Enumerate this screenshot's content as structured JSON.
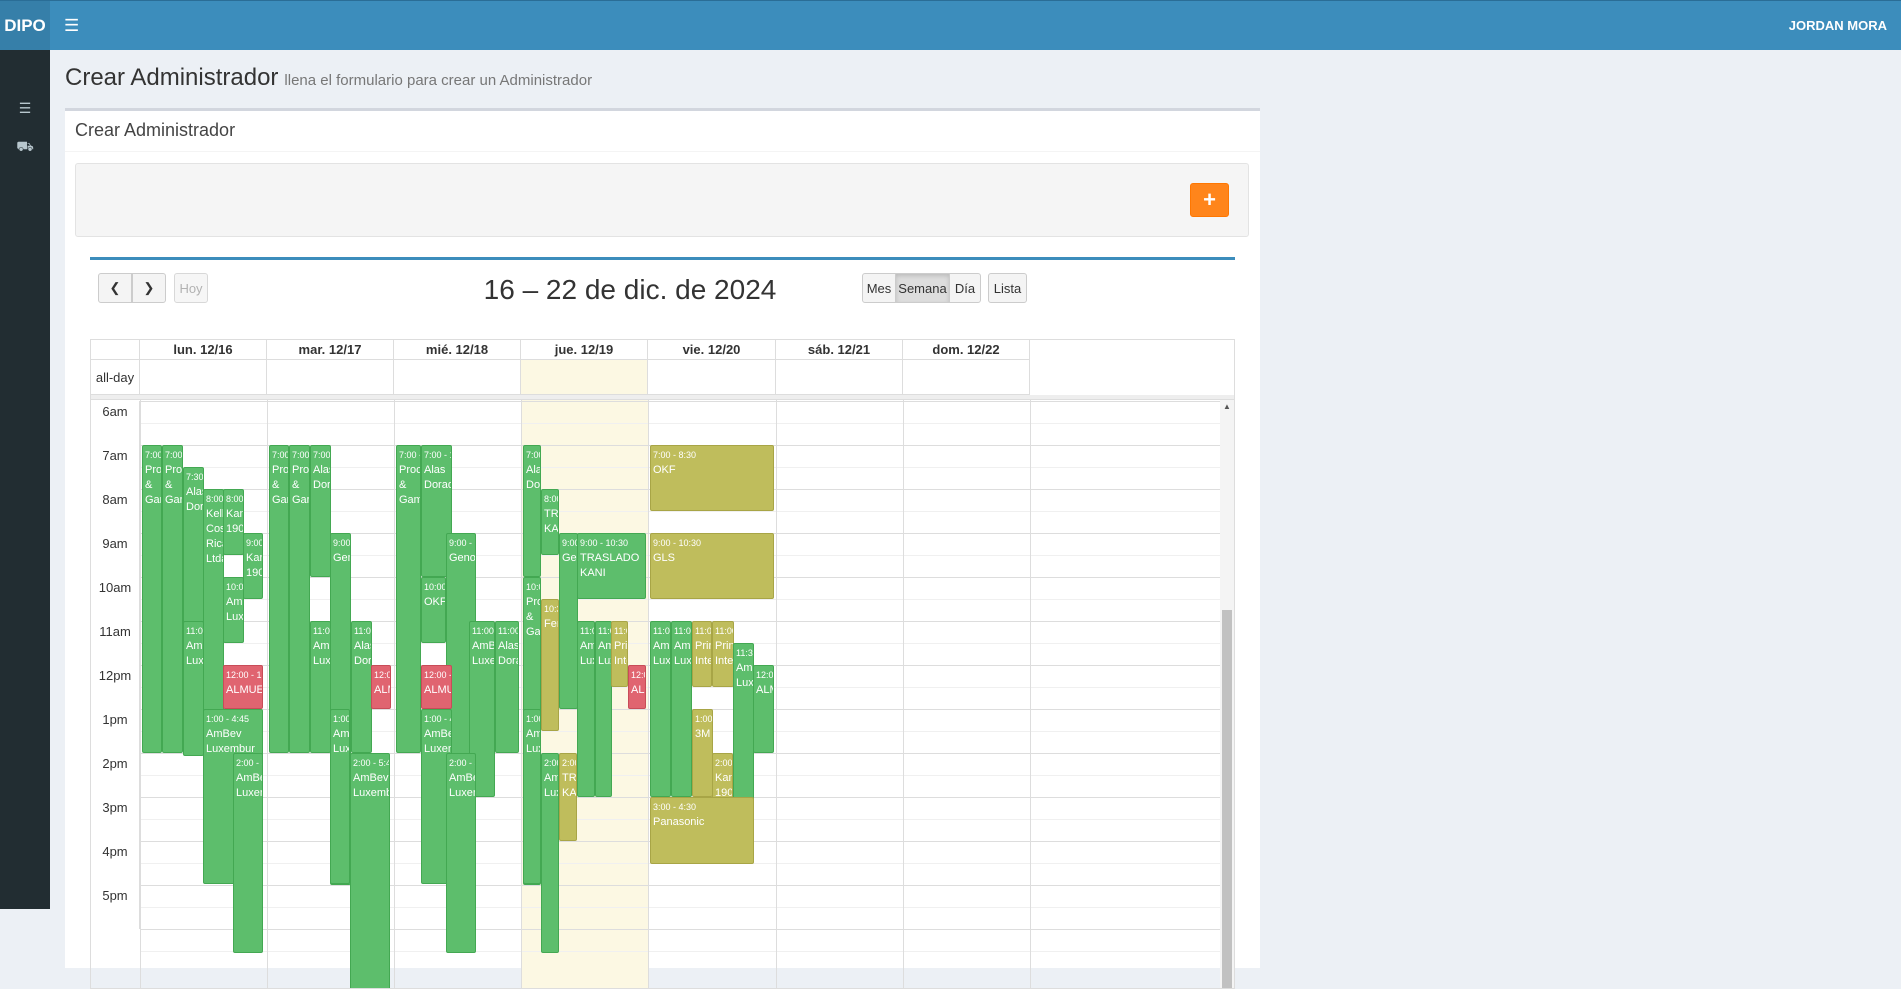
{
  "topbar": {
    "logo": "DIPO",
    "user": "JORDAN MORA",
    "menu_icon": "hamburger-icon"
  },
  "sidebar": {
    "items": [
      {
        "icon": "list-icon"
      },
      {
        "icon": "truck-icon"
      }
    ]
  },
  "page": {
    "title": "Crear Administrador",
    "subtitle": "llena el formulario para crear un Administrador"
  },
  "box": {
    "title": "Crear Administrador",
    "add_label": "+"
  },
  "calendar": {
    "title": "16 – 22 de dic. de 2024",
    "today_label": "Hoy",
    "views": [
      "Mes",
      "Semana",
      "Día",
      "Lista"
    ],
    "active_view": "Semana",
    "allday_label": "all-day",
    "days": [
      "lun. 12/16",
      "mar. 12/17",
      "mié. 12/18",
      "jue. 12/19",
      "vie. 12/20",
      "sáb. 12/21",
      "dom. 12/22"
    ],
    "times": [
      "6am",
      "7am",
      "8am",
      "9am",
      "10am",
      "11am",
      "12pm",
      "1pm",
      "2pm",
      "3pm",
      "4pm",
      "5pm"
    ]
  },
  "colors": {
    "green": "#5dbe6c",
    "olive": "#bfbd5c",
    "red": "#e06470",
    "header": "#3c8dbc",
    "add": "#ff851b"
  },
  "events": [
    {
      "day": 0,
      "time": "7:00 -",
      "title": "Proc & Gam"
    },
    {
      "day": 0,
      "time": "7:00 -",
      "title": "Proc & Gam"
    },
    {
      "day": 0,
      "time": "7:30 -",
      "title": "Alas Dora"
    },
    {
      "day": 0,
      "time": "8:00 -",
      "title": "Kello Cost Rica Ltda"
    },
    {
      "day": 0,
      "time": "8:00 -",
      "title": "Kani 1901"
    },
    {
      "day": 0,
      "time": "9:00 -",
      "title": "Kani 1901"
    },
    {
      "day": 0,
      "time": "10:00 -",
      "title": "AmBe Luxem"
    },
    {
      "day": 0,
      "time": "11:00",
      "title": "AmB Luxe"
    },
    {
      "day": 0,
      "time": "12:00 - 1:00",
      "title": "ALMUERZO"
    },
    {
      "day": 0,
      "time": "1:00 - 4:45",
      "title": "AmBev Luxembur"
    },
    {
      "day": 0,
      "time": "2:00 - 5:45",
      "title": "AmBev Luxemb"
    },
    {
      "day": 1,
      "time": "7:00 -",
      "title": "Proc & Gam"
    },
    {
      "day": 1,
      "time": "7:00 -",
      "title": "Proc & Gam"
    },
    {
      "day": 1,
      "time": "7:00 -",
      "title": "Alas Dorad"
    },
    {
      "day": 1,
      "time": "9:00 -",
      "title": "Geno"
    },
    {
      "day": 1,
      "time": "11:00",
      "title": "AmB Luxe"
    },
    {
      "day": 1,
      "time": "11:00",
      "title": "Alas Dora"
    },
    {
      "day": 1,
      "time": "12:00",
      "title": "ALM"
    },
    {
      "day": 1,
      "time": "1:00 -",
      "title": "AmB Luxe"
    },
    {
      "day": 1,
      "time": "2:00 - 5:45",
      "title": "AmBev Luxembu"
    },
    {
      "day": 2,
      "time": "7:00 - 1",
      "title": "Proct & Gamb"
    },
    {
      "day": 2,
      "time": "7:00 - 10",
      "title": "Alas Dorada"
    },
    {
      "day": 2,
      "time": "9:00 - 12",
      "title": "Genom"
    },
    {
      "day": 2,
      "time": "10:00 -",
      "title": "OKF"
    },
    {
      "day": 2,
      "time": "11:00",
      "title": "AmBe Luxem"
    },
    {
      "day": 2,
      "time": "11:00",
      "title": "Alas Dorad"
    },
    {
      "day": 2,
      "time": "12:00 -",
      "title": "ALMUER"
    },
    {
      "day": 2,
      "time": "1:00 - 4:4",
      "title": "AmBev Luxemb"
    },
    {
      "day": 2,
      "time": "2:00 - 5:",
      "title": "AmBe Luxem"
    },
    {
      "day": 3,
      "time": "7:00",
      "title": "Alas Dor"
    },
    {
      "day": 3,
      "time": "8:00",
      "title": "TRA KAN"
    },
    {
      "day": 3,
      "time": "9:00",
      "title": "Gen"
    },
    {
      "day": 3,
      "time": "9:00 - 10:30",
      "title": "TRASLADO KANI"
    },
    {
      "day": 3,
      "time": "10:0",
      "title": "Proc & Gam"
    },
    {
      "day": 3,
      "time": "10:30",
      "title": "Ferr"
    },
    {
      "day": 3,
      "time": "11:0",
      "title": "Ami Luxe"
    },
    {
      "day": 3,
      "time": "11:0",
      "title": "Ami Luxe"
    },
    {
      "day": 3,
      "time": "11:00",
      "title": "Prin Inte"
    },
    {
      "day": 3,
      "time": "12:00",
      "title": "ALM"
    },
    {
      "day": 3,
      "time": "1:00",
      "title": "Ami Luxe"
    },
    {
      "day": 3,
      "time": "2:00",
      "title": "Ami Luxe"
    },
    {
      "day": 3,
      "time": "2:00",
      "title": "TRA KAN"
    },
    {
      "day": 4,
      "time": "7:00 - 8:30",
      "title": "OKF"
    },
    {
      "day": 4,
      "time": "9:00 - 10:30",
      "title": "GLS"
    },
    {
      "day": 4,
      "time": "11:00",
      "title": "AmB Luxe"
    },
    {
      "day": 4,
      "time": "11:00",
      "title": "AmB Luxe"
    },
    {
      "day": 4,
      "time": "11:00",
      "title": "Prin Inter"
    },
    {
      "day": 4,
      "time": "11:00",
      "title": "Prin Inter"
    },
    {
      "day": 4,
      "time": "11:30",
      "title": "AmB Luxe"
    },
    {
      "day": 4,
      "time": "12:00",
      "title": "ALM"
    },
    {
      "day": 4,
      "time": "1:00 - 2",
      "title": "3M"
    },
    {
      "day": 4,
      "time": "2:00 -",
      "title": "Kani 1901"
    },
    {
      "day": 4,
      "time": "3:00 - 4:30",
      "title": "Panasonic"
    }
  ]
}
